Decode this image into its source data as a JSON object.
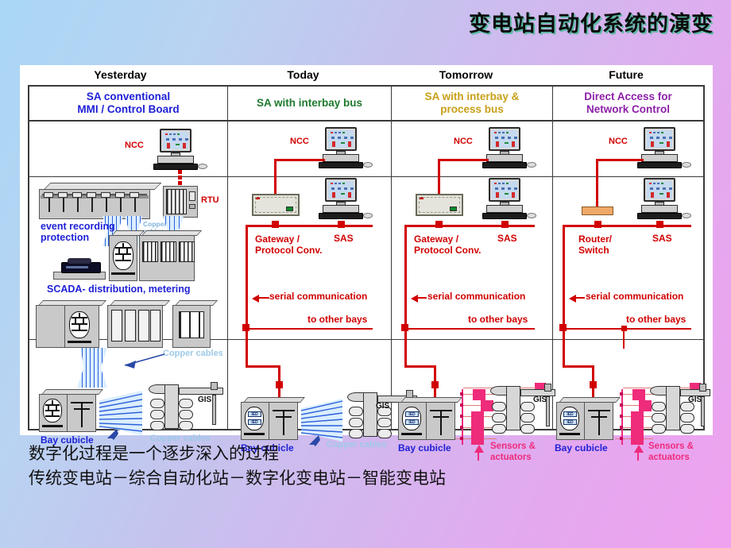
{
  "slide": {
    "title": "变电站自动化系统的演变",
    "bottom_lines": [
      "数字化过程是一个逐步深入的过程",
      "传统变电站－综合自动化站－数字化变电站－智能变电站"
    ]
  },
  "colors": {
    "bg_start": "#a9d7f5",
    "bg_end": "#efa2ef",
    "red_network": "#d10000",
    "blue_label": "#1f21d6",
    "pink_process": "#ef2b7b",
    "copper_cable": "#9ec9e8",
    "green_header": "#1f7a2e",
    "gold_header": "#c8a018",
    "purple_header": "#8c1fa8"
  },
  "table": {
    "era_headers": [
      "Yesterday",
      "Today",
      "Tomorrow",
      "Future"
    ],
    "sub_headers": [
      "SA conventional\nMMI / Control Board",
      "SA with interbay bus",
      "SA with interbay &\nprocess bus",
      "Direct Access for\nNetwork Control"
    ],
    "columns": [
      {
        "era": "Yesterday",
        "ncc_label": "NCC",
        "labels": [
          "RTU",
          "Copper\ncables",
          "event recording\nprotection",
          "SCADA- distribution, metering",
          "Copper cables",
          "Bay cubicle",
          "Copper cables",
          "GIS"
        ]
      },
      {
        "era": "Today",
        "ncc_label": "NCC",
        "labels": [
          "Gateway /\nProtocol Conv.",
          "SAS",
          "serial communication",
          "to other bays",
          "Bay cubicle",
          "Copper cables",
          "GIS",
          "IED"
        ]
      },
      {
        "era": "Tomorrow",
        "ncc_label": "NCC",
        "labels": [
          "Gateway /\nProtocol Conv.",
          "SAS",
          "serial communication",
          "to other bays",
          "Bay cubicle",
          "Sensors &\nactuators",
          "GIS",
          "IED"
        ]
      },
      {
        "era": "Future",
        "ncc_label": "NCC",
        "labels": [
          "Router/\nSwitch",
          "SAS",
          "serial communication",
          "to other bays",
          "Bay cubicle",
          "Sensors &\nactuators",
          "GIS",
          "IED"
        ]
      }
    ]
  },
  "labels": {
    "ncc": "NCC",
    "rtu": "RTU",
    "sas": "SAS",
    "gis": "GIS",
    "ied": "IED",
    "copper_cables": "Copper cables",
    "copper_cables_2line": "Copper\ncables",
    "event_recording": "event recording\nprotection",
    "scada": "SCADA- distribution, metering",
    "bay_cubicle": "Bay cubicle",
    "gateway": "Gateway /\nProtocol Conv.",
    "router": "Router/\nSwitch",
    "serial_comm": "serial communication",
    "other_bays": "to other bays",
    "sensors": "Sensors &\nactuators"
  }
}
